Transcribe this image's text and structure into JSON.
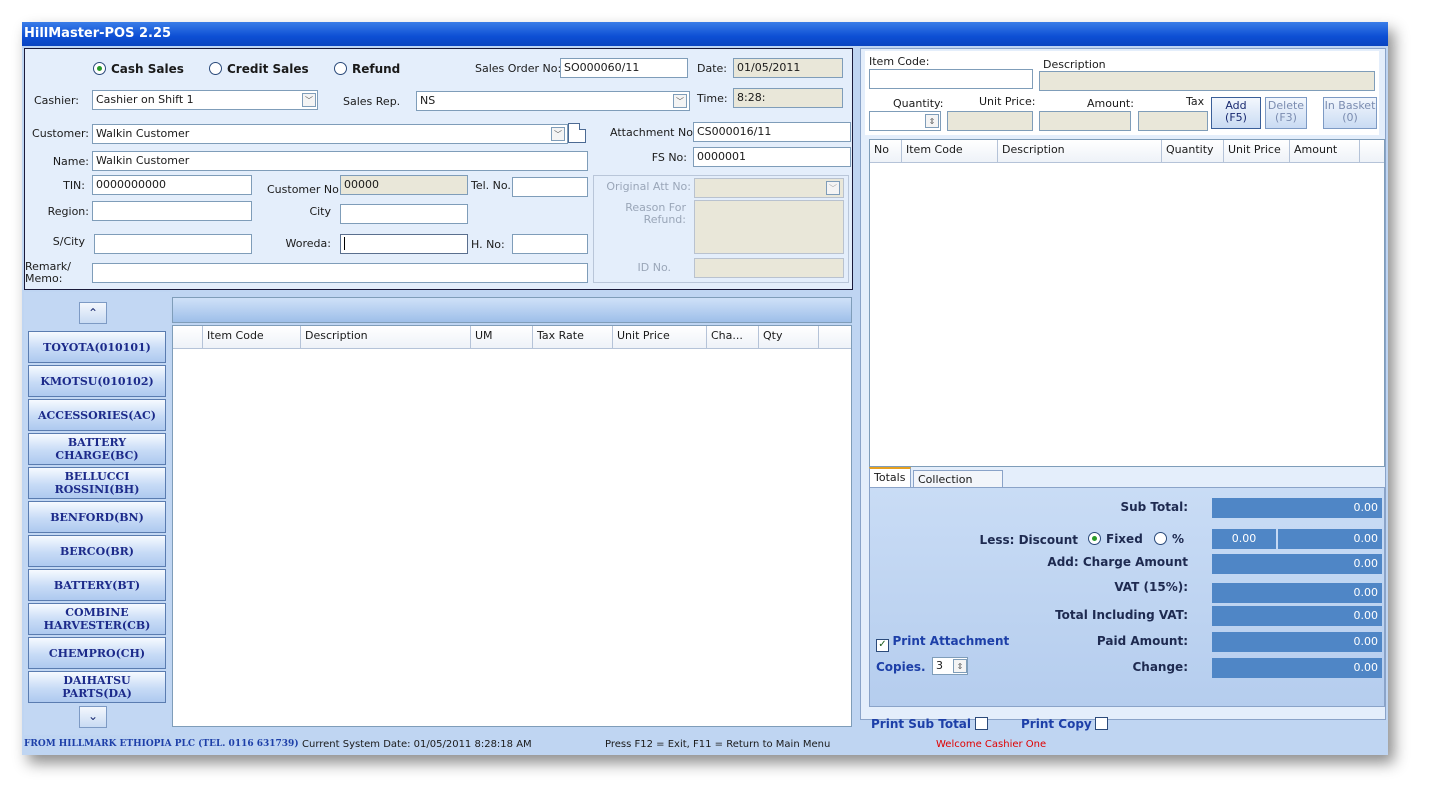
{
  "window": {
    "title": "HillMaster-POS 2.25"
  },
  "sale_type": {
    "options": [
      "Cash Sales",
      "Credit Sales",
      "Refund"
    ],
    "selected": "Cash Sales"
  },
  "order": {
    "sales_order_label": "Sales Order No:",
    "sales_order_value": "SO000060/11",
    "date_label": "Date:",
    "date_value": "01/05/2011",
    "time_label": "Time:",
    "time_value": "8:28:"
  },
  "form": {
    "cashier_label": "Cashier:",
    "cashier_value": "Cashier on Shift 1",
    "sales_rep_label": "Sales Rep.",
    "sales_rep_value": "NS",
    "customer_label": "Customer:",
    "customer_value": "Walkin Customer",
    "attachment_label": "Attachment No:",
    "attachment_value": "CS000016/11",
    "name_label": "Name:",
    "name_value": "Walkin Customer",
    "fs_label": "FS No:",
    "fs_value": "0000001",
    "tin_label": "TIN:",
    "tin_value": "0000000000",
    "customer_no_label": "Customer No:",
    "customer_no_value": "00000",
    "tel_label": "Tel. No.",
    "tel_value": "",
    "region_label": "Region:",
    "region_value": "",
    "city_label": "City",
    "city_value": "",
    "scity_label": "S/City",
    "scity_value": "",
    "woreda_label": "Woreda:",
    "woreda_value": "",
    "hno_label": "H. No:",
    "hno_value": "",
    "remark_label_1": "Remark/",
    "remark_label_2": "Memo:",
    "remark_value": "",
    "orig_att_label": "Original Att No:",
    "orig_att_value": "",
    "reason_label_1": "Reason For",
    "reason_label_2": "Refund:",
    "reason_value": "",
    "id_label": "ID No.",
    "id_value": ""
  },
  "categories": [
    {
      "line1": "TOYOTA(010101)",
      "line2": ""
    },
    {
      "line1": "KMOTSU(010102)",
      "line2": ""
    },
    {
      "line1": "ACCESSORIES(AC)",
      "line2": ""
    },
    {
      "line1": "BATTERY",
      "line2": "CHARGE(BC)"
    },
    {
      "line1": "BELLUCCI",
      "line2": "ROSSINI(BH)"
    },
    {
      "line1": "BENFORD(BN)",
      "line2": ""
    },
    {
      "line1": "BERCO(BR)",
      "line2": ""
    },
    {
      "line1": "BATTERY(BT)",
      "line2": ""
    },
    {
      "line1": "COMBINE",
      "line2": "HARVESTER(CB)"
    },
    {
      "line1": "CHEMPRO(CH)",
      "line2": ""
    },
    {
      "line1": "DAIHATSU",
      "line2": "PARTS(DA)"
    }
  ],
  "items_grid": {
    "columns": [
      "",
      "Item Code",
      "Description",
      "UM",
      "Tax Rate",
      "Unit Price",
      "Cha...",
      "Qty"
    ]
  },
  "entry": {
    "item_code_label": "Item Code:",
    "item_code_value": "",
    "description_label": "Description",
    "description_value": "",
    "quantity_label": "Quantity:",
    "quantity_value": "",
    "unit_price_label": "Unit Price:",
    "unit_price_value": "",
    "amount_label": "Amount:",
    "amount_value": "",
    "tax_label": "Tax",
    "tax_value": "",
    "add_label": "Add",
    "add_key": "(F5)",
    "delete_label": "Delete",
    "delete_key": "(F3)",
    "basket_label": "In Basket",
    "basket_count": "(0)"
  },
  "basket_grid": {
    "columns": [
      "No",
      "Item Code",
      "Description",
      "Quantity",
      "Unit Price",
      "Amount"
    ]
  },
  "tabs": [
    "Totals",
    "Collection Details"
  ],
  "totals": {
    "sub_total_label": "Sub Total:",
    "sub_total": "0.00",
    "discount_label": "Less: Discount",
    "fixed_label": "Fixed",
    "percent_label": "%",
    "discount_mode": "Fixed",
    "discount_input": "0.00",
    "discount_value": "0.00",
    "charge_label": "Add: Charge Amount",
    "charge_value": "0.00",
    "vat_label": "VAT (15%):",
    "vat_value": "0.00",
    "total_vat_label": "Total Including VAT:",
    "total_vat_value": "0.00",
    "paid_label": "Paid Amount:",
    "paid_value": "0.00",
    "change_label": "Change:",
    "change_value": "0.00",
    "print_attachment_label": "Print Attachment",
    "print_attachment_checked": true,
    "copies_label": "Copies.",
    "copies_value": "3",
    "print_sub_total_label": "Print Sub Total",
    "print_copy_label": "Print Copy"
  },
  "status": {
    "company": "FROM HILLMARK ETHIOPIA PLC  (TEL. 0116 631739)",
    "system_date": "Current System Date: 01/05/2011 8:28:18 AM",
    "keys": "Press   F12  =  Exit,   F11 = Return to Main Menu",
    "welcome": "Welcome Cashier One"
  },
  "colors": {
    "titlebar": "#0d4fd4",
    "totals_value": "#4f86c6",
    "welcome": "#e00000",
    "company": "#1d3fa8"
  }
}
